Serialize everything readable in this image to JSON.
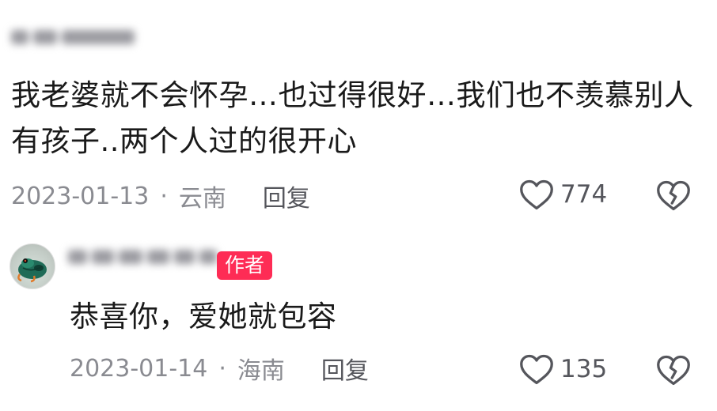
{
  "comments": [
    {
      "username": "",
      "text": "我老婆就不会怀孕…也过得很好…我们也不羡慕别人有孩子..两个人过的很开心",
      "date": "2023-01-13",
      "separator": "·",
      "location": "云南",
      "reply_label": "回复",
      "like_count": "774",
      "is_author": false
    },
    {
      "username": "",
      "author_badge": "作者",
      "text": "恭喜你，爱她就包容",
      "date": "2023-01-14",
      "separator": "·",
      "location": "海南",
      "reply_label": "回复",
      "like_count": "135",
      "is_author": true
    }
  ],
  "icons": {
    "like": "heart-outline-icon",
    "dislike": "broken-heart-icon",
    "avatar": "frog-avatar"
  },
  "colors": {
    "author_badge_bg": "#fe2c55",
    "meta_text": "#8a8b91",
    "body_text": "#1a1a1a"
  }
}
